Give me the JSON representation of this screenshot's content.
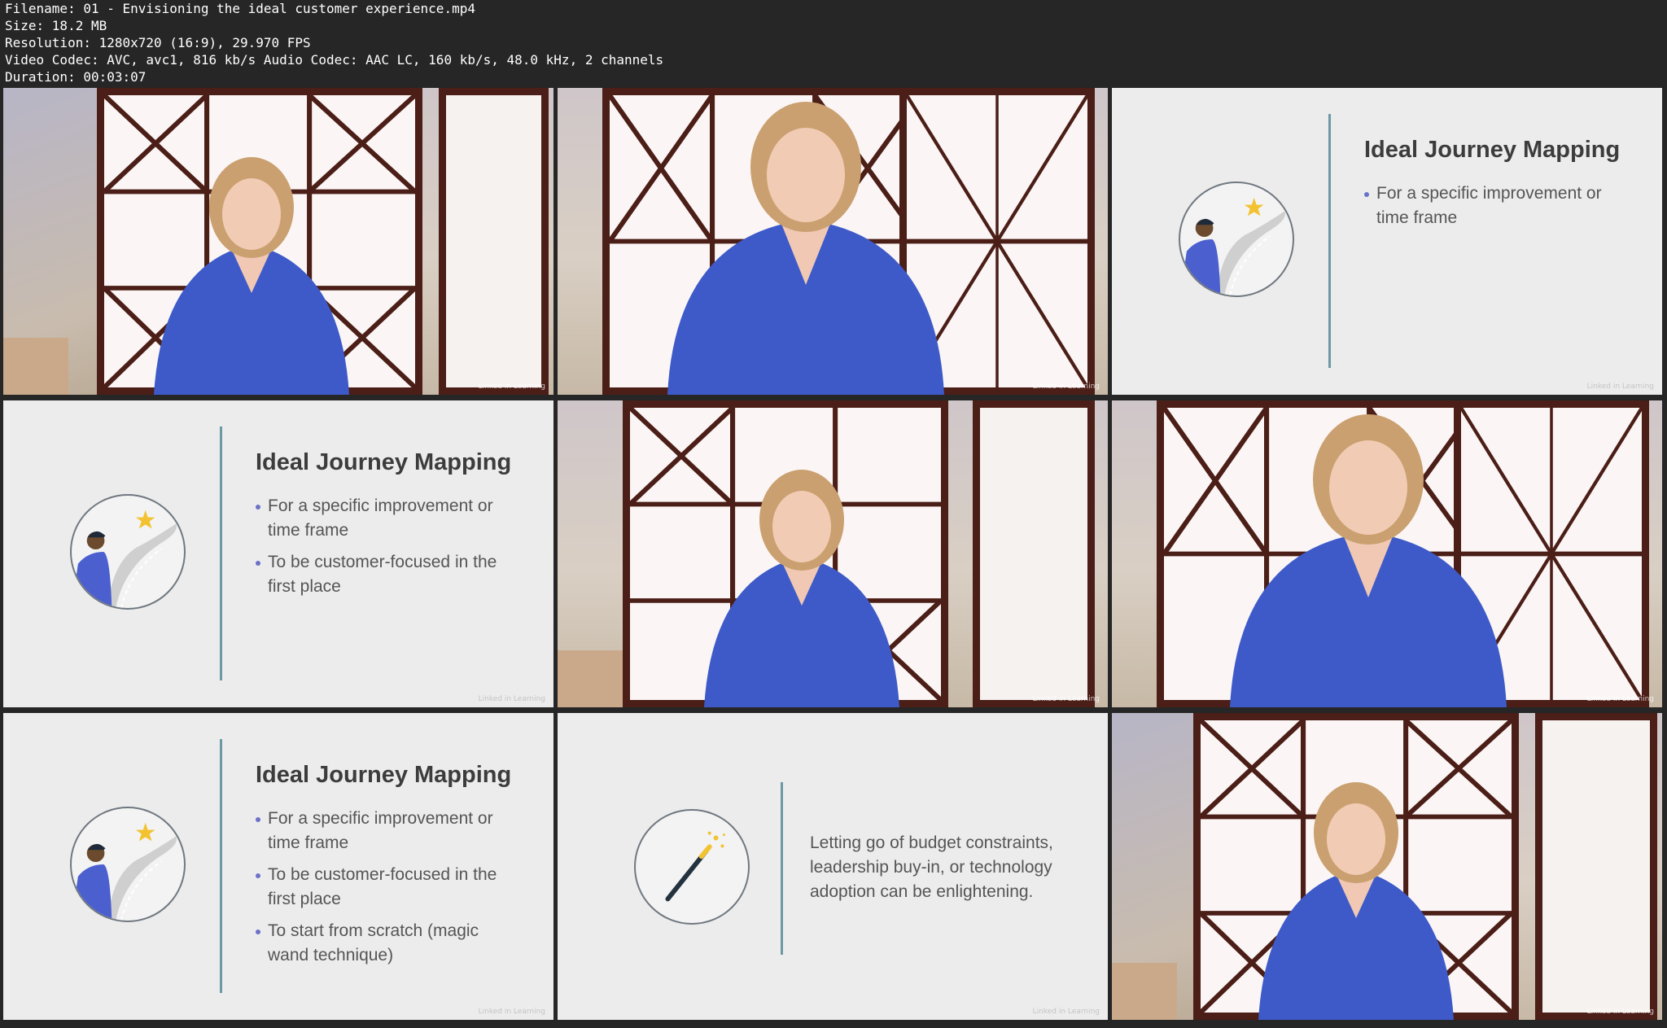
{
  "file_info": {
    "filename": "Filename: 01 - Envisioning the ideal customer experience.mp4",
    "size": "Size: 18.2 MB",
    "resolution": "Resolution: 1280x720 (16:9), 29.970 FPS",
    "codec": "Video Codec: AVC, avc1, 816 kb/s Audio Codec: AAC LC, 160 kb/s, 48.0 kHz, 2 channels",
    "duration": "Duration: 00:03:07"
  },
  "watermark": "Linked in Learning",
  "colors": {
    "background": "#262626",
    "slide_background": "#ececec",
    "divider_line": "#6b9aa6",
    "bullet_dot": "#6a72c8",
    "presenter_shirt": "#3d5ac8",
    "screen_frame": "#4b1e17",
    "star": "#f2c230"
  },
  "slides": {
    "journey_title": "Ideal Journey Mapping",
    "bullet_1": "For a specific improvement or time frame",
    "bullet_2": "To be customer-focused in the first place",
    "bullet_3": "To start from scratch (magic wand technique)",
    "magic_wand_text": "Letting go of budget constraints, leadership buy-in, or technology adoption can be enlightening."
  },
  "icons": {
    "journey": "person-road-star-icon",
    "wand": "magic-wand-icon"
  }
}
